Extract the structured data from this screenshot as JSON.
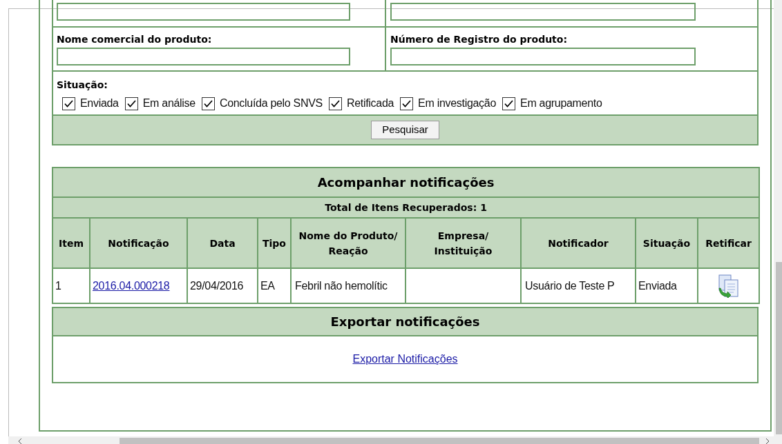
{
  "form": {
    "fields_top": [
      {
        "kind": "text"
      },
      {
        "kind": "text"
      }
    ],
    "fields": [
      {
        "label": "Nome comercial do produto:",
        "kind": "text"
      },
      {
        "label": "Número de Registro do produto:",
        "kind": "text"
      }
    ],
    "situacao": {
      "label": "Situação:",
      "options": [
        {
          "label": "Enviada",
          "checked": true
        },
        {
          "label": "Em análise",
          "checked": true
        },
        {
          "label": "Concluída pelo SNVS",
          "checked": true
        },
        {
          "label": "Retificada",
          "checked": true
        },
        {
          "label": "Em investigação",
          "checked": true
        },
        {
          "label": "Em agrupamento",
          "checked": true
        }
      ]
    },
    "search_button": "Pesquisar"
  },
  "results": {
    "title": "Acompanhar notificações",
    "total": "Total de Itens Recuperados: 1",
    "columns": [
      "Item",
      "Notificação",
      "Data",
      "Tipo",
      "Nome do Produto/ Reação",
      "Empresa/ Instituição",
      "Notificador",
      "Situação",
      "Retificar"
    ],
    "rows": [
      {
        "item": "1",
        "notificacao": "2016.04.000218",
        "data": "29/04/2016",
        "tipo": "EA",
        "produto": "Febril não hemolític",
        "notificador": "Usuário de Teste P",
        "situacao": "Enviada"
      }
    ]
  },
  "export": {
    "title": "Exportar notificações",
    "link": "Exportar Notificações"
  }
}
